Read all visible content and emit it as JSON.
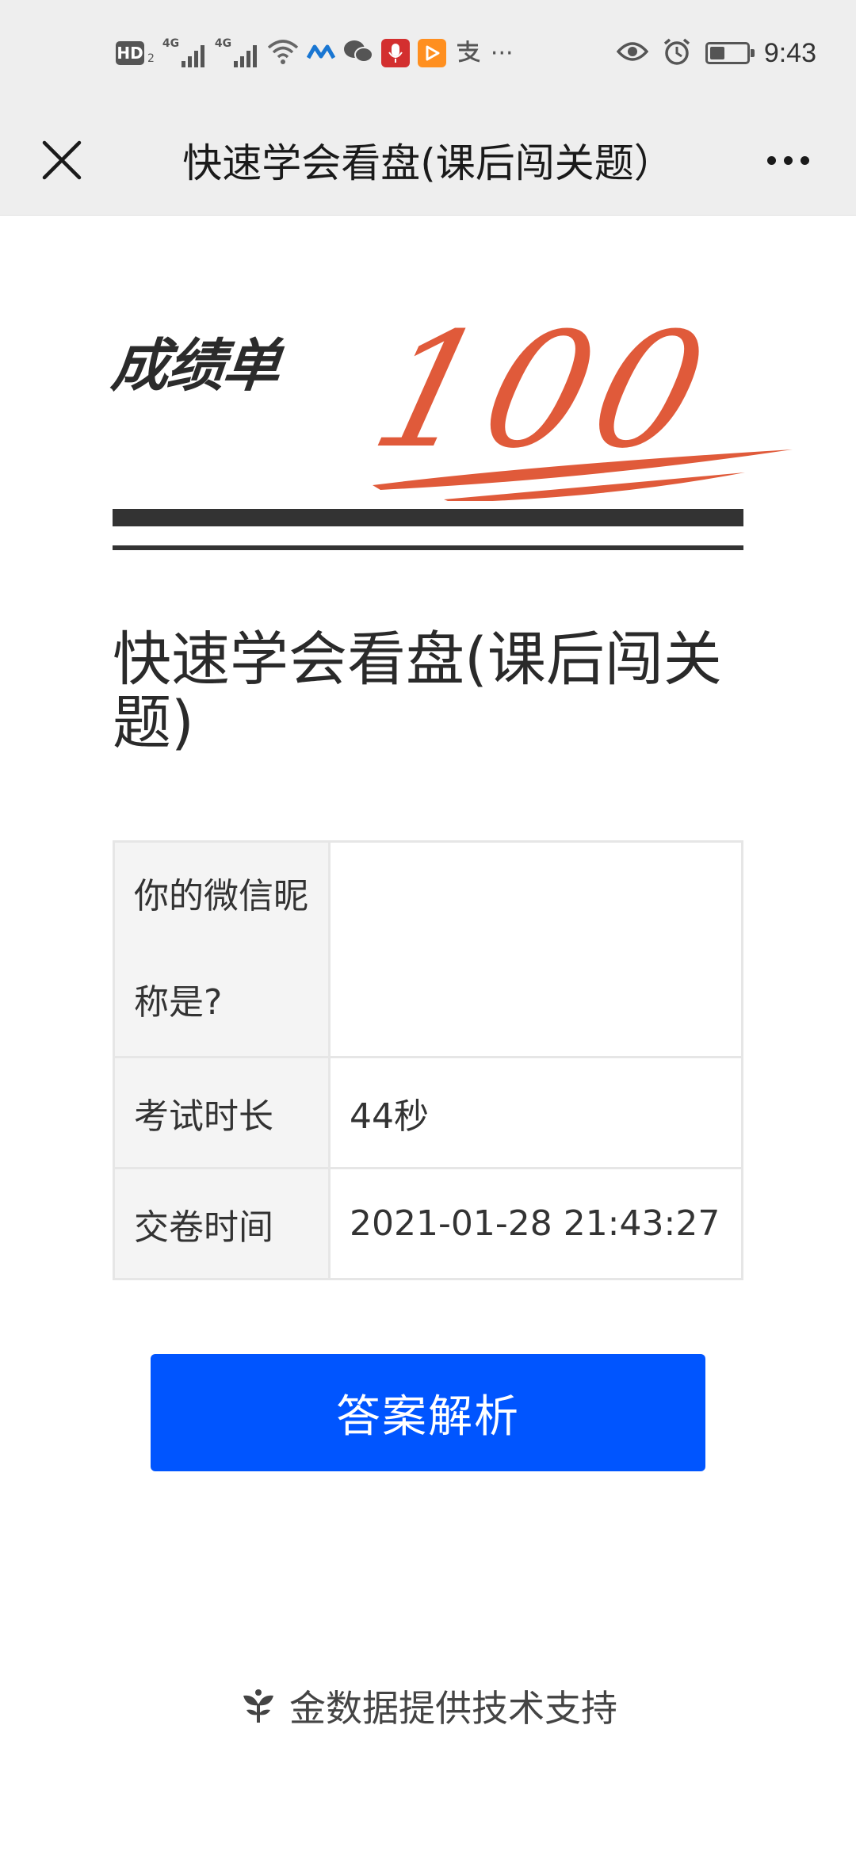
{
  "status_bar": {
    "hd_label": "HD",
    "hd_sub": "2",
    "net1_label": "4G",
    "net2_label": "4G",
    "time": "9:43",
    "battery_level": 0.4,
    "app_icons": [
      "wifi-icon",
      "app-icon",
      "wechat-icon",
      "mic-icon",
      "video-icon",
      "alipay-icon"
    ],
    "more_icon": "···"
  },
  "nav": {
    "title": "快速学会看盘(课后闯关题）"
  },
  "report": {
    "heading": "成绩单",
    "score": "100",
    "accent_color": "#e05a3a"
  },
  "quiz_title": "快速学会看盘(课后闯关题)",
  "info_table": {
    "rows": [
      {
        "label": "你的微信昵称是?",
        "value": ""
      },
      {
        "label": "考试时长",
        "value": "44秒"
      },
      {
        "label": "交卷时间",
        "value": "2021-01-28 21:43:27"
      }
    ]
  },
  "answer_button": {
    "label": "答案解析",
    "color": "#0055ff"
  },
  "footer": {
    "text": "金数据提供技术支持"
  }
}
